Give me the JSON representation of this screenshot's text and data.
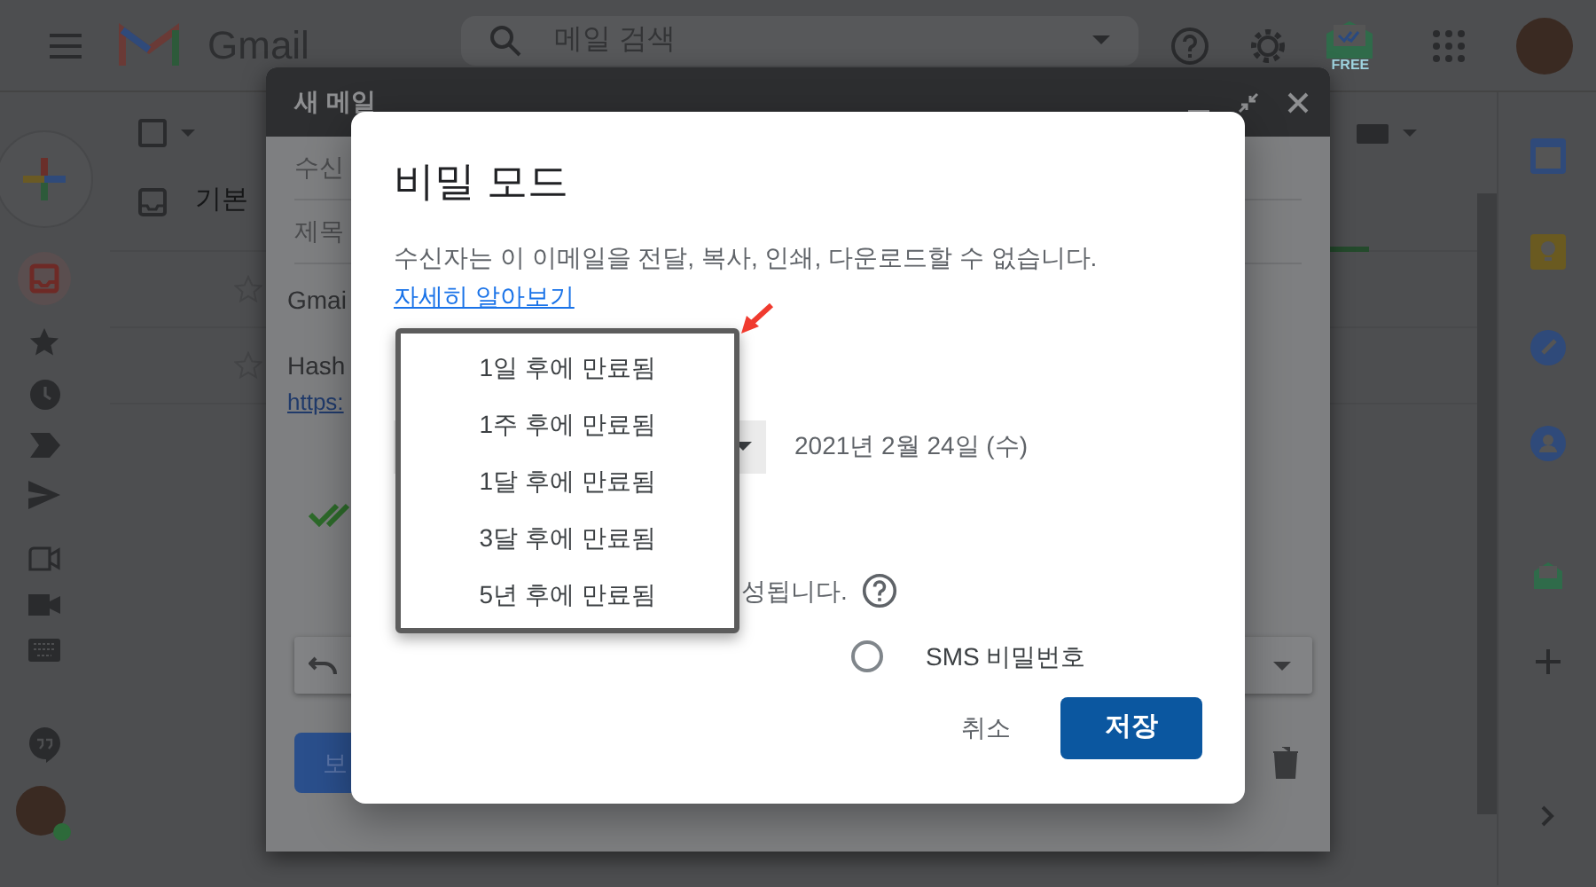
{
  "topbar": {
    "app_name": "Gmail",
    "search": {
      "placeholder": "메일 검색"
    },
    "addon_badge": "FREE"
  },
  "mail_list": {
    "select_all": {
      "checked": false
    },
    "tab": "기본"
  },
  "compose": {
    "title": "새 메일",
    "fields": [
      "수신",
      "제목"
    ],
    "body": [
      "Gmai",
      "Hash"
    ],
    "link": "https:",
    "send_label": "보"
  },
  "dialog": {
    "title": "비밀 모드",
    "description": "수신자는 이 이메일을 전달, 복사, 인쇄, 다운로드할 수 없습니다.",
    "learn_more": "자세히 알아보기",
    "expiry_date": "2021년 2월 24일 (수)",
    "passcode_note": "성됩니다.",
    "passcode_options": [
      {
        "label": "SMS 비밀번호",
        "selected": false
      }
    ],
    "buttons": [
      {
        "label": "취소",
        "kind": "text"
      },
      {
        "label": "저장",
        "kind": "primary"
      }
    ],
    "expiry_menu": [
      {
        "label": "1일 후에 만료됨",
        "selected": false
      },
      {
        "label": "1주 후에 만료됨",
        "selected": false
      },
      {
        "label": "1달 후에 만료됨",
        "selected": false
      },
      {
        "label": "3달 후에 만료됨",
        "selected": false
      },
      {
        "label": "5년 후에 만료됨",
        "selected": false
      }
    ]
  }
}
